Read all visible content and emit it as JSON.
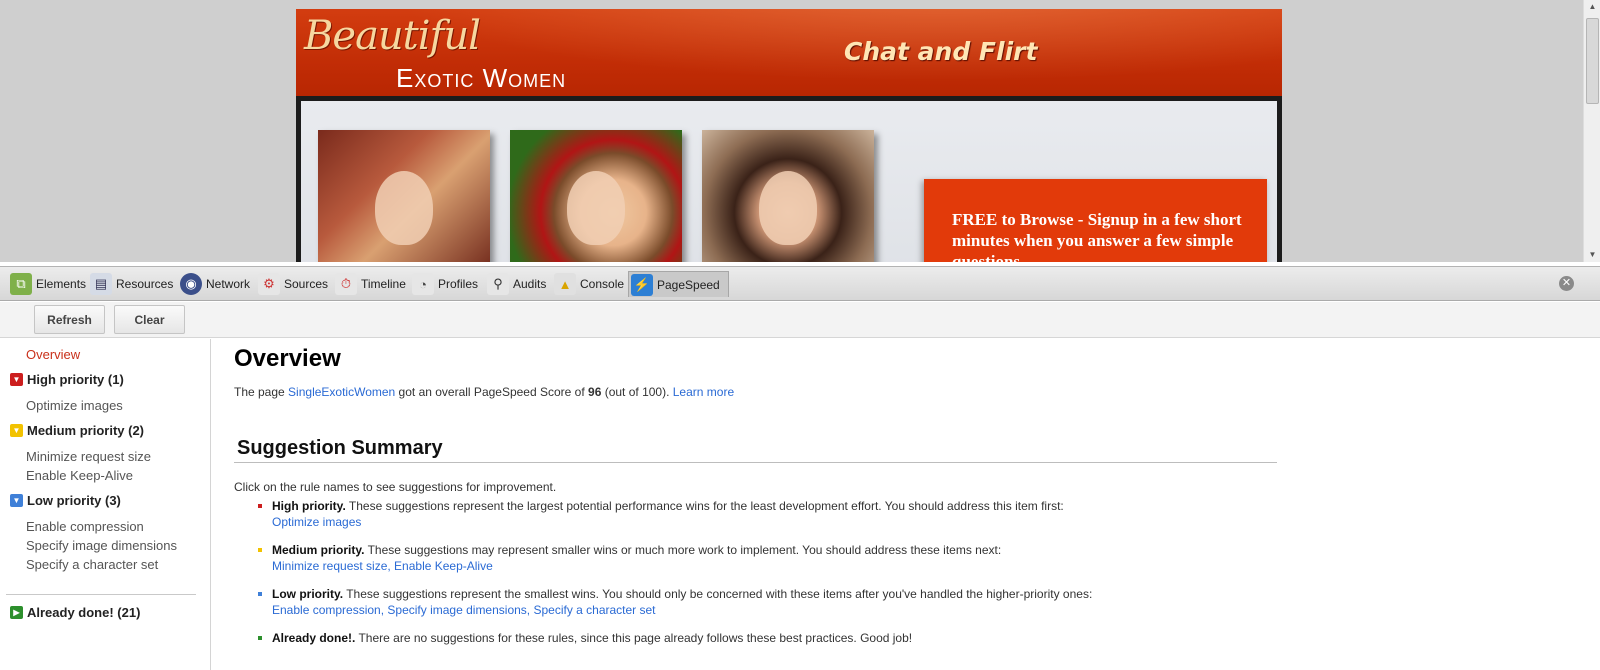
{
  "site": {
    "logo_script": "Beautiful",
    "logo_sub": "Exotic Women",
    "tagline": "Chat and Flirt",
    "promo_lead": "FREE to Browse - ",
    "promo_rest": "Signup in a few short minutes when you answer a few simple questions"
  },
  "devtools": {
    "tabs": [
      {
        "label": "Elements",
        "icon": "elements-icon"
      },
      {
        "label": "Resources",
        "icon": "resources-icon"
      },
      {
        "label": "Network",
        "icon": "network-icon"
      },
      {
        "label": "Sources",
        "icon": "sources-icon"
      },
      {
        "label": "Timeline",
        "icon": "timeline-icon"
      },
      {
        "label": "Profiles",
        "icon": "profiles-icon"
      },
      {
        "label": "Audits",
        "icon": "audits-icon"
      },
      {
        "label": "Console",
        "icon": "console-icon"
      },
      {
        "label": "PageSpeed",
        "icon": "pagespeed-icon"
      }
    ],
    "active_tab": "PageSpeed"
  },
  "toolbar": {
    "refresh_label": "Refresh",
    "clear_label": "Clear"
  },
  "nav": {
    "overview": "Overview",
    "high": {
      "label": "High priority (1)",
      "color": "#cc1e1e",
      "items": [
        "Optimize images"
      ]
    },
    "medium": {
      "label": "Medium priority (2)",
      "color": "#f2c200",
      "items": [
        "Minimize request size",
        "Enable Keep-Alive"
      ]
    },
    "low": {
      "label": "Low priority (3)",
      "color": "#3f80d8",
      "items": [
        "Enable compression",
        "Specify image dimensions",
        "Specify a character set"
      ]
    },
    "done": {
      "label": "Already done! (21)",
      "color": "#2c8f2c"
    }
  },
  "main": {
    "title": "Overview",
    "score": {
      "prefix": "The page ",
      "page_name": "SingleExoticWomen",
      "middle": " got an overall PageSpeed Score of ",
      "score": "96",
      "suffix": " (out of 100). ",
      "learn_more": "Learn more"
    },
    "summary_title": "Suggestion Summary",
    "click_hint": "Click on the rule names to see suggestions for improvement.",
    "suggestions": [
      {
        "label": "High priority.",
        "text": " These suggestions represent the largest potential performance wins for the least development effort. You should address this item first:",
        "links": "Optimize images",
        "color": "#cc1e1e"
      },
      {
        "label": "Medium priority.",
        "text": " These suggestions may represent smaller wins or much more work to implement. You should address these items next:",
        "links": "Minimize request size, Enable Keep-Alive",
        "color": "#f2c200"
      },
      {
        "label": "Low priority.",
        "text": " These suggestions represent the smallest wins. You should only be concerned with these items after you've handled the higher-priority ones:",
        "links": "Enable compression, Specify image dimensions, Specify a character set",
        "color": "#3f80d8"
      },
      {
        "label": "Already done!.",
        "text": " There are no suggestions for these rules, since this page already follows these best practices. Good job!",
        "links": "",
        "color": "#2c8f2c"
      }
    ]
  }
}
